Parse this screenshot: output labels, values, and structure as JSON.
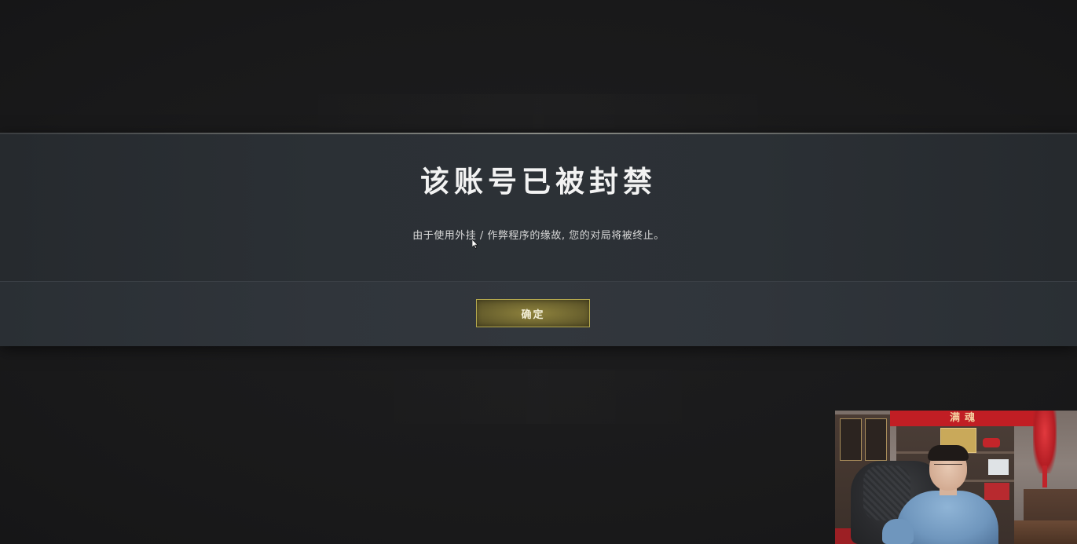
{
  "dialog": {
    "title": "该账号已被封禁",
    "message": "由于使用外挂 / 作弊程序的缘故, 您的对局将被终止。",
    "confirm_label": "确定"
  },
  "webcam": {
    "banner_text": "满魂"
  },
  "colors": {
    "background": "#1b1b1c",
    "panel": "#2c3136",
    "button_gold": "#8f833d",
    "button_border": "#b5a94e"
  }
}
